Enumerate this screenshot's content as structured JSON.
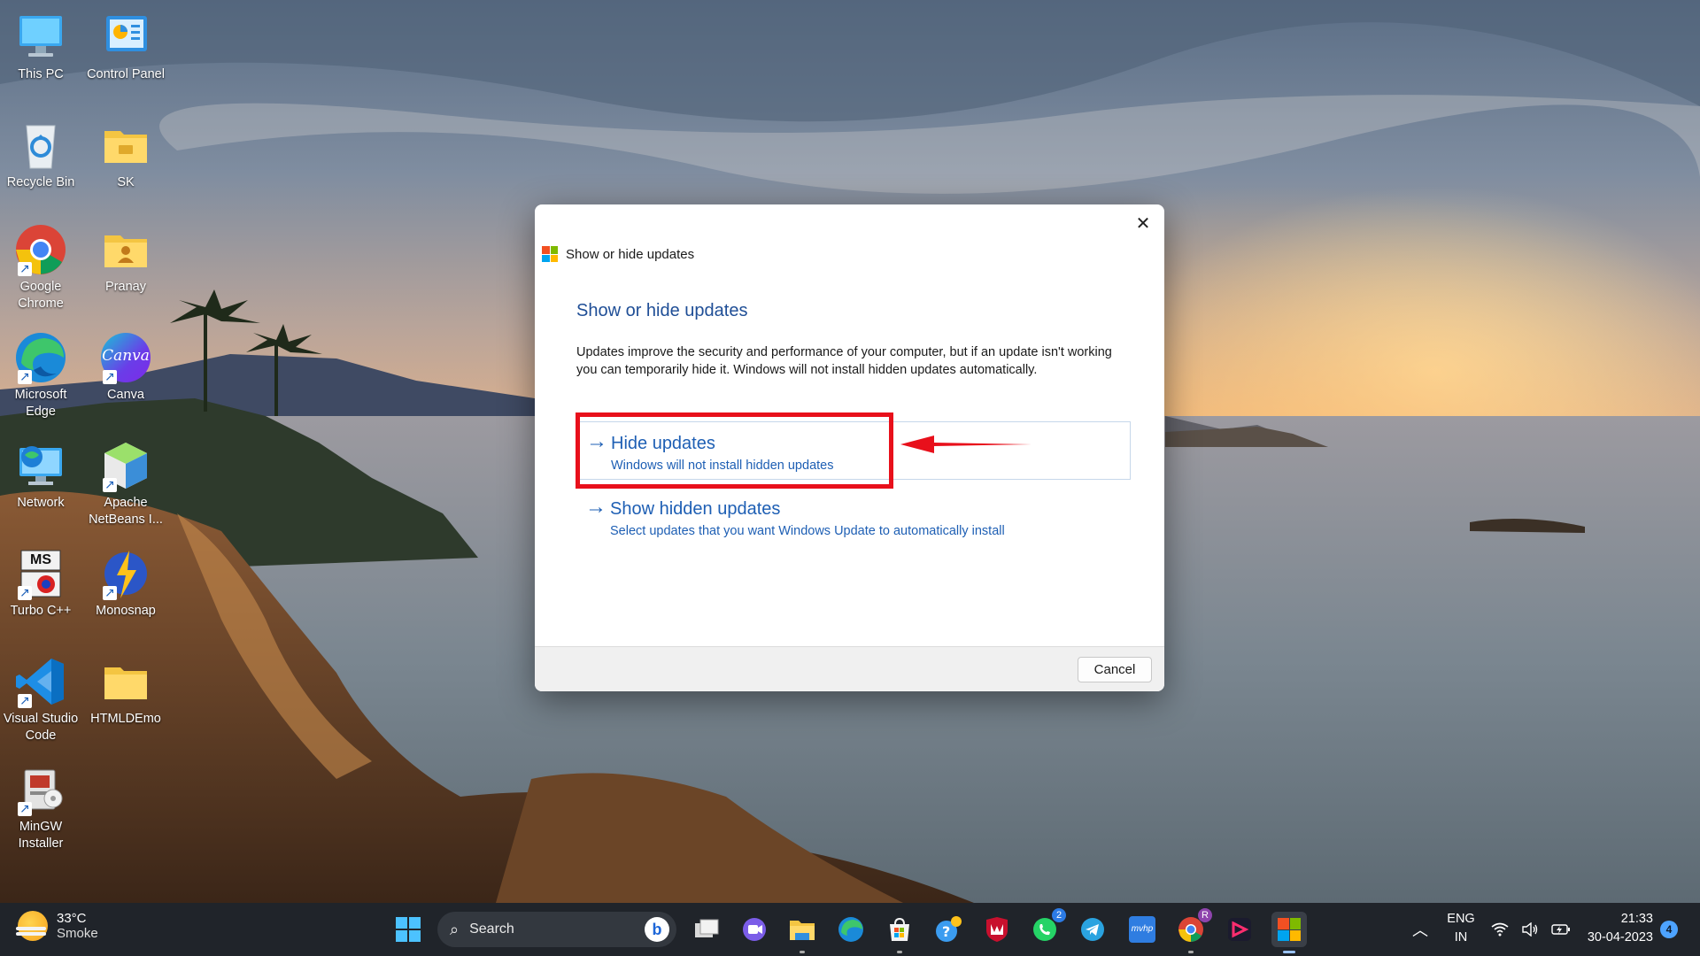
{
  "desktop": {
    "icons": [
      {
        "label": "This PC"
      },
      {
        "label": "Control Panel"
      },
      {
        "label": "Recycle Bin"
      },
      {
        "label": "SK"
      },
      {
        "label": "Google Chrome"
      },
      {
        "label": "Pranay"
      },
      {
        "label": "Microsoft Edge"
      },
      {
        "label": "Canva"
      },
      {
        "label": "Network"
      },
      {
        "label": "Apache NetBeans I..."
      },
      {
        "label": "Turbo C++"
      },
      {
        "label": "Monosnap"
      },
      {
        "label": "Visual Studio Code"
      },
      {
        "label": "HTMLDEmo"
      },
      {
        "label": "MinGW Installer"
      }
    ],
    "canva_logo_text": "Canva",
    "turbo_logo_text": "MS"
  },
  "dialog": {
    "window_title": "Show or hide updates",
    "heading": "Show or hide updates",
    "description": "Updates improve the security and performance of your computer, but if an update isn't working you can temporarily hide it. Windows will not install hidden updates automatically.",
    "options": [
      {
        "title": "Hide updates",
        "subtitle": "Windows will not install hidden updates"
      },
      {
        "title": "Show hidden updates",
        "subtitle": "Select updates that you want Windows Update to automatically install"
      }
    ],
    "cancel_label": "Cancel",
    "close_glyph": "✕",
    "arrow_glyph": "→"
  },
  "annotation": {
    "color": "#e8101b"
  },
  "taskbar": {
    "weather_temp": "33°C",
    "weather_desc": "Smoke",
    "search_label": "Search",
    "bing_letter": "b",
    "whatsapp_badge": "2",
    "chrome_badge": "R",
    "lang_line1": "ENG",
    "lang_line2": "IN",
    "time": "21:33",
    "date": "30-04-2023",
    "notification_count": "4",
    "mmt_label": "mvhp"
  },
  "colors": {
    "link": "#1e5fb4",
    "heading": "#1f4e96",
    "taskbar": "#20242a"
  }
}
